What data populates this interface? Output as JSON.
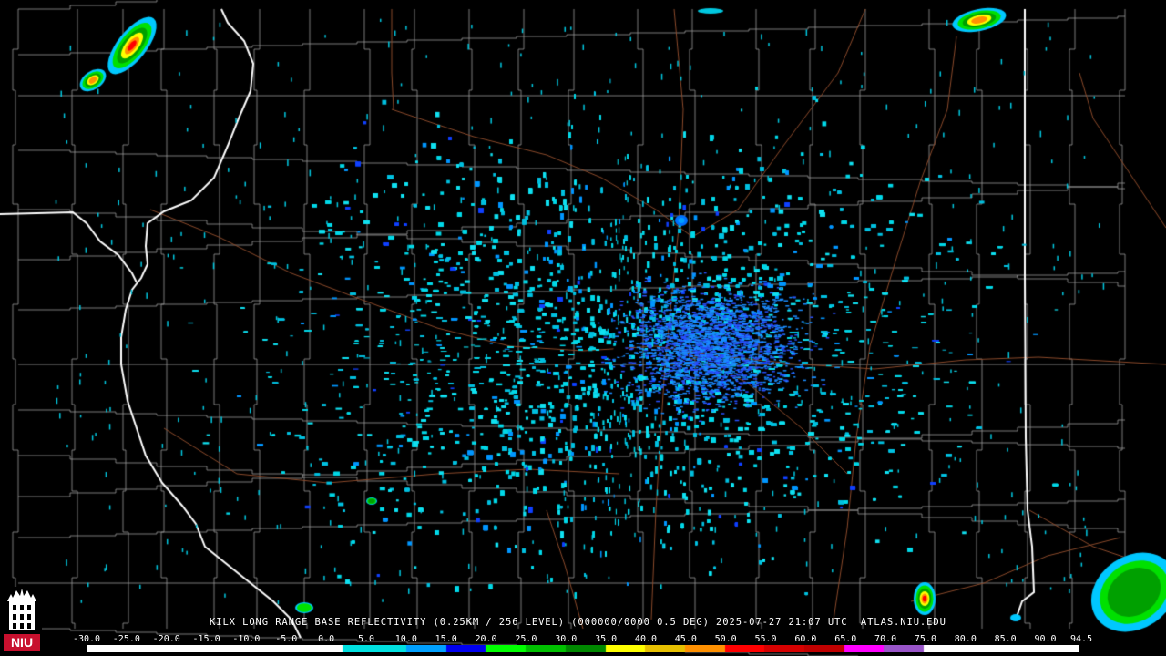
{
  "product": {
    "radar_site": "KILX",
    "caption": "KILX LONG RANGE BASE REFLECTIVITY (0.25KM / 256 LEVEL) (000000/0000 0.5 DEG) 2025-07-27 21:07 UTC  ATLAS.NIU.EDU",
    "timestamp": "2025-07-27 21:07 UTC",
    "source": "ATLAS.NIU.EDU",
    "elevation": "0.5 DEG"
  },
  "logo": {
    "text": "NIU",
    "color": "#c8102e"
  },
  "colorbar": {
    "labels": [
      "-30.0",
      "-25.0",
      "-20.0",
      "-15.0",
      "-10.0",
      "-5.0",
      "0.0",
      "5.0",
      "10.0",
      "15.0",
      "20.0",
      "25.0",
      "30.0",
      "35.0",
      "40.0",
      "45.0",
      "50.0",
      "55.0",
      "60.0",
      "65.0",
      "70.0",
      "75.0",
      "80.0",
      "85.0",
      "90.0",
      "94.5"
    ],
    "stops": [
      {
        "value": -30,
        "color": "#ffffff"
      },
      {
        "value": 0,
        "color": "#ffffff"
      },
      {
        "value": 2,
        "color": "#00e0e0"
      },
      {
        "value": 10,
        "color": "#00a0ff"
      },
      {
        "value": 15,
        "color": "#0000f0"
      },
      {
        "value": 20,
        "color": "#00ff00"
      },
      {
        "value": 25,
        "color": "#00c000"
      },
      {
        "value": 30,
        "color": "#008800"
      },
      {
        "value": 35,
        "color": "#ffff00"
      },
      {
        "value": 40,
        "color": "#e7c000"
      },
      {
        "value": 45,
        "color": "#ff9000"
      },
      {
        "value": 50,
        "color": "#ff0000"
      },
      {
        "value": 55,
        "color": "#d60000"
      },
      {
        "value": 60,
        "color": "#c00000"
      },
      {
        "value": 65,
        "color": "#ff00ff"
      },
      {
        "value": 70,
        "color": "#9955c9"
      },
      {
        "value": 75,
        "color": "#ffffff"
      },
      {
        "value": 94.5,
        "color": "#ffffff"
      }
    ]
  },
  "colors": {
    "background": "#000000",
    "county_lines": "#9a9a9a",
    "state_lines": "#ffffff",
    "highways": "#8b4a2b"
  }
}
